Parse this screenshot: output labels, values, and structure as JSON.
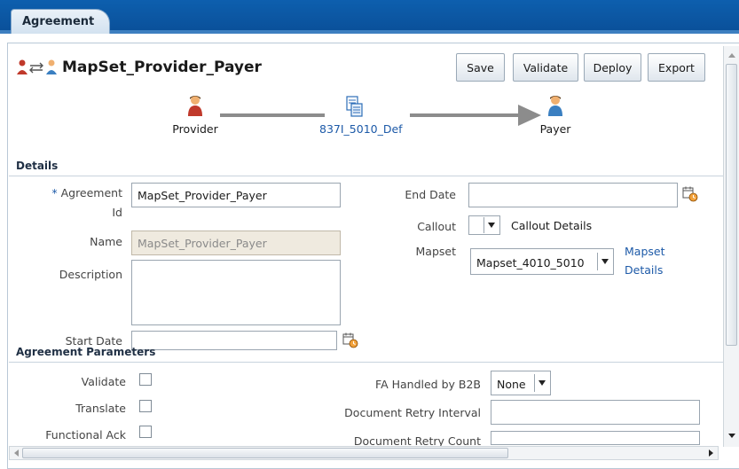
{
  "tabs": [
    {
      "label": "Agreement"
    }
  ],
  "header": {
    "title": "MapSet_Provider_Payer"
  },
  "toolbar": {
    "save": "Save",
    "validate": "Validate",
    "deploy": "Deploy",
    "export": "Export"
  },
  "flow": {
    "source": "Provider",
    "document": "837I_5010_Def",
    "target": "Payer"
  },
  "details": {
    "heading": "Details",
    "agreement_id_label_1": "Agreement",
    "agreement_id_label_2": "Id",
    "agreement_id_value": "MapSet_Provider_Payer",
    "name_label": "Name",
    "name_value": "MapSet_Provider_Payer",
    "description_label": "Description",
    "description_value": "",
    "start_date_label": "Start Date",
    "start_date_value": "",
    "end_date_label": "End Date",
    "end_date_value": "",
    "callout_label": "Callout",
    "callout_value": "",
    "callout_details_label": "Callout Details",
    "mapset_label": "Mapset",
    "mapset_value": "Mapset_4010_5010",
    "mapset_details_1": "Mapset",
    "mapset_details_2": "Details"
  },
  "parameters": {
    "heading": "Agreement Parameters",
    "validate_label": "Validate",
    "translate_label": "Translate",
    "functional_ack_label": "Functional Ack",
    "fa_handled_label": "FA Handled by B2B",
    "fa_handled_value": "None",
    "retry_interval_label": "Document Retry Interval",
    "retry_interval_value": "",
    "retry_count_label": "Document Retry Count"
  },
  "colors": {
    "accent": "#0d5fae",
    "link": "#1d5aa8"
  },
  "icons": {
    "title": "provider-payer-icon",
    "source": "person-red-icon",
    "document": "document-def-icon",
    "target": "person-blue-icon",
    "calendar": "calendar-clock-icon"
  }
}
